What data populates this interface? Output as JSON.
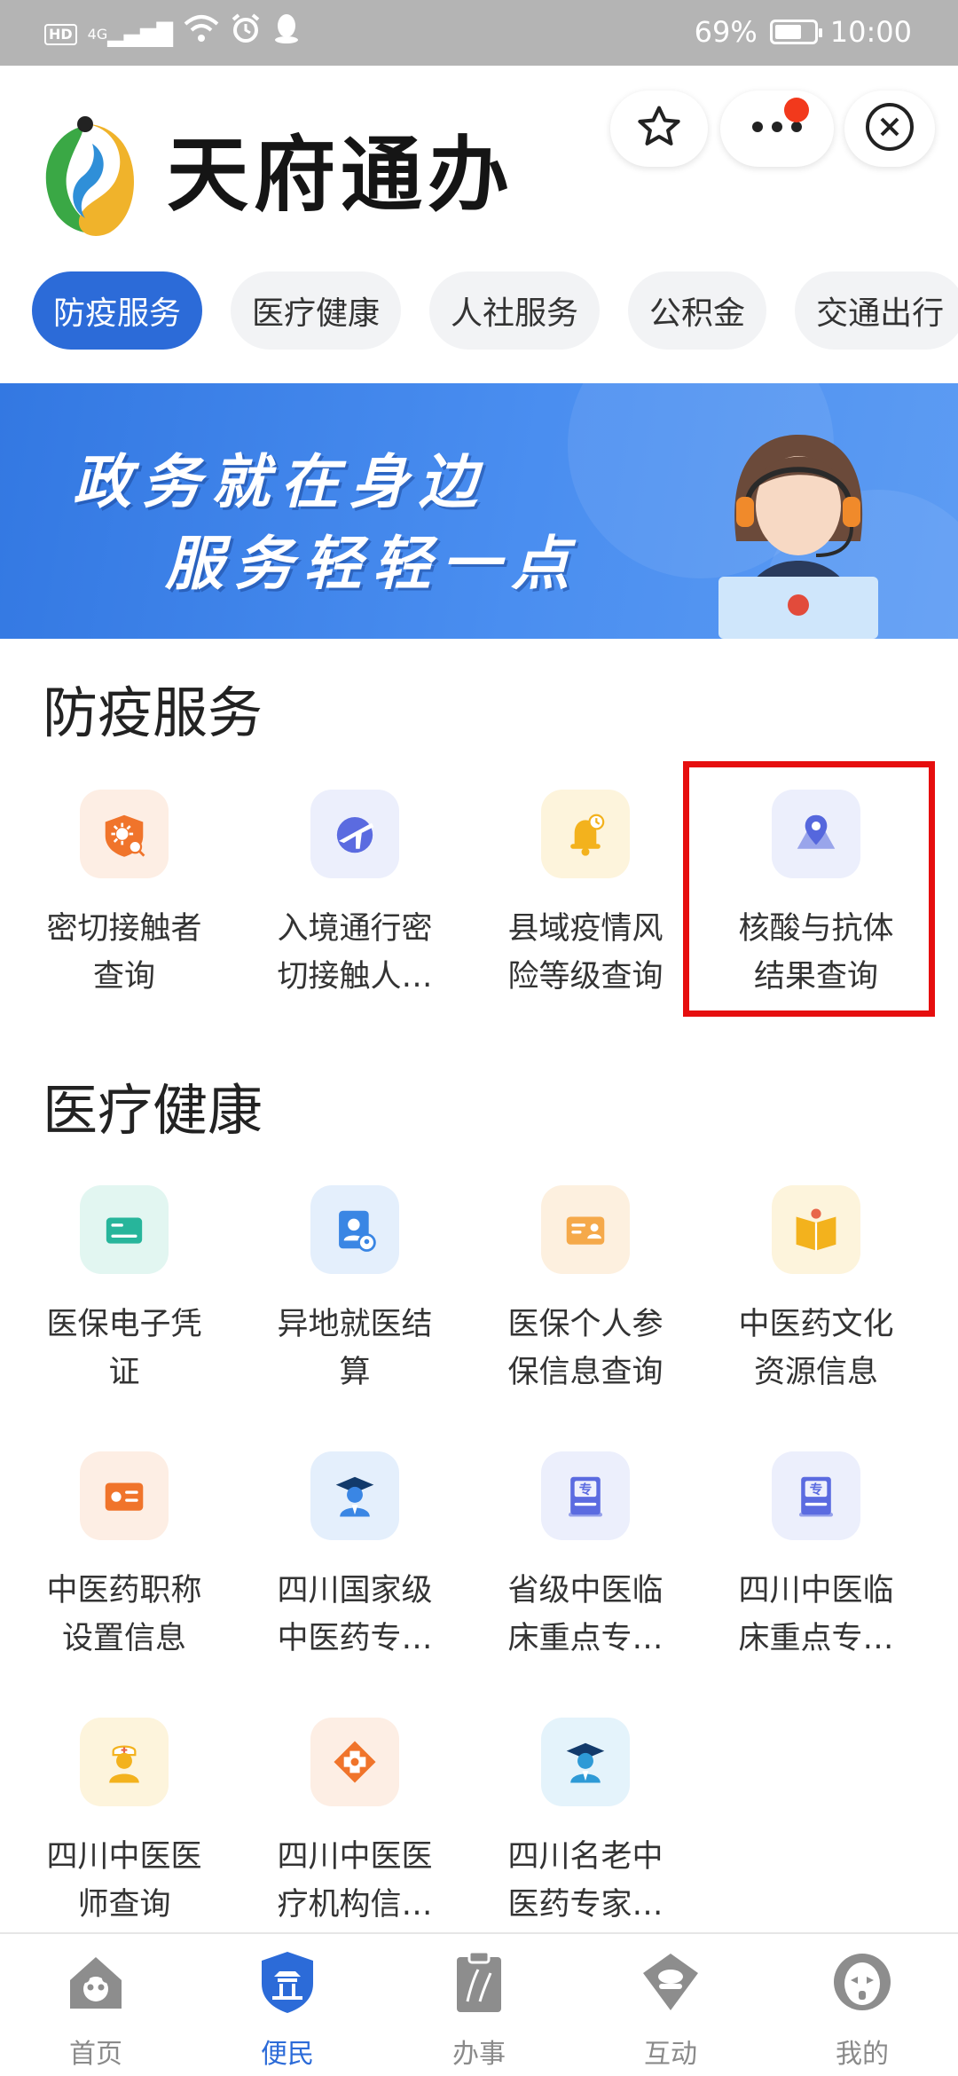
{
  "status_bar": {
    "network_tags": [
      "HD",
      "4G"
    ],
    "battery_text": "69%",
    "battery_level": 0.69,
    "time": "10:00"
  },
  "header": {
    "app_title": "天府通办",
    "icons": [
      "star-icon",
      "more-icon",
      "close-circle-icon"
    ]
  },
  "tabs": [
    {
      "label": "防疫服务",
      "active": true
    },
    {
      "label": "医疗健康",
      "active": false
    },
    {
      "label": "人社服务",
      "active": false
    },
    {
      "label": "公积金",
      "active": false
    },
    {
      "label": "交通出行",
      "active": false
    }
  ],
  "banner": {
    "line1": "政务就在身边",
    "line2": "服务轻轻一点"
  },
  "sections": [
    {
      "title": "防疫服务",
      "items": [
        {
          "label": "密切接触者查询",
          "icon": "virus-search-icon",
          "bg": "#fdeee4",
          "color": "#f0742b"
        },
        {
          "label": "入境通行密切接触人…",
          "icon": "plane-globe-icon",
          "bg": "#eceffc",
          "color": "#5b6be0"
        },
        {
          "label": "县域疫情风险等级查询",
          "icon": "alarm-bell-icon",
          "bg": "#fdf4dc",
          "color": "#f3b21d"
        },
        {
          "label": "核酸与抗体结果查询",
          "icon": "map-location-icon",
          "bg": "#eceffc",
          "color": "#5567dd"
        }
      ]
    },
    {
      "title": "医疗健康",
      "items": [
        {
          "label": "医保电子凭证",
          "icon": "card-icon",
          "bg": "#e2f6f1",
          "color": "#27b59b"
        },
        {
          "label": "异地就医结算",
          "icon": "user-location-icon",
          "bg": "#e4effc",
          "color": "#3a86e4"
        },
        {
          "label": "医保个人参保信息查询",
          "icon": "id-card-icon",
          "bg": "#fdf0df",
          "color": "#f5a94a"
        },
        {
          "label": "中医药文化资源信息",
          "icon": "open-book-icon",
          "bg": "#fdf4dc",
          "color": "#f3b21d"
        },
        {
          "label": "中医药职称设置信息",
          "icon": "certificate-icon",
          "bg": "#fdeee4",
          "color": "#f0742b"
        },
        {
          "label": "四川国家级中医药专…",
          "icon": "graduate-icon",
          "bg": "#e4effc",
          "color": "#3a86e4"
        },
        {
          "label": "省级中医临床重点专…",
          "icon": "specialist-book-icon",
          "bg": "#eceffc",
          "color": "#5b6be0"
        },
        {
          "label": "四川中医临床重点专…",
          "icon": "specialist-book-icon",
          "bg": "#eceffc",
          "color": "#5b6be0"
        },
        {
          "label": "四川中医医师查询",
          "icon": "nurse-icon",
          "bg": "#fdf4dc",
          "color": "#f3b21d"
        },
        {
          "label": "四川中医医疗机构信…",
          "icon": "medical-cross-icon",
          "bg": "#fdeee4",
          "color": "#f0742b"
        },
        {
          "label": "四川名老中医药专家…",
          "icon": "graduate-icon",
          "bg": "#e4f3fb",
          "color": "#2e9ad6"
        }
      ]
    }
  ],
  "bottom_nav": [
    {
      "label": "首页",
      "icon": "home-panda-icon",
      "active": false
    },
    {
      "label": "便民",
      "icon": "shield-temple-icon",
      "active": true
    },
    {
      "label": "办事",
      "icon": "clipboard-icon",
      "active": false
    },
    {
      "label": "互动",
      "icon": "interact-icon",
      "active": false
    },
    {
      "label": "我的",
      "icon": "opera-mask-icon",
      "active": false
    }
  ],
  "colors": {
    "accent": "#2c6bd8",
    "highlight": "#e60e0e",
    "status_bar": "#b4b4b4"
  }
}
